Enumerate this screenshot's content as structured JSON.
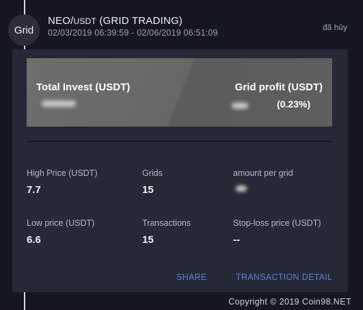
{
  "header": {
    "badge": "Grid",
    "title_pair_base": "NEO/",
    "title_pair_quote": "USDT",
    "title_suffix": " (GRID TRADING)",
    "time_range": "02/03/2019 06:39:59 - 02/06/2019 06:51:09",
    "status": "đã hủy"
  },
  "banner": {
    "total_invest_label": "Total Invest (USDT)",
    "grid_profit_label": "Grid profit (USDT)",
    "grid_profit_percent": "(0.23%)"
  },
  "details": {
    "high_price_label": "High Price (USDT)",
    "high_price_value": "7.7",
    "grids_label": "Grids",
    "grids_value": "15",
    "amount_per_grid_label": "amount per grid",
    "low_price_label": "Low price (USDT)",
    "low_price_value": "6.6",
    "transactions_label": "Transactions",
    "transactions_value": "15",
    "stop_loss_label": "Stop-loss price (USDT)",
    "stop_loss_value": "--"
  },
  "actions": {
    "share": "SHARE",
    "transaction_detail": "TRANSACTION DETAIL"
  },
  "footer": {
    "copyright": "Copyright © 2019 Coin98.NET"
  },
  "colors": {
    "background": "#141722",
    "card": "#252936",
    "link": "#5b7fd1"
  }
}
